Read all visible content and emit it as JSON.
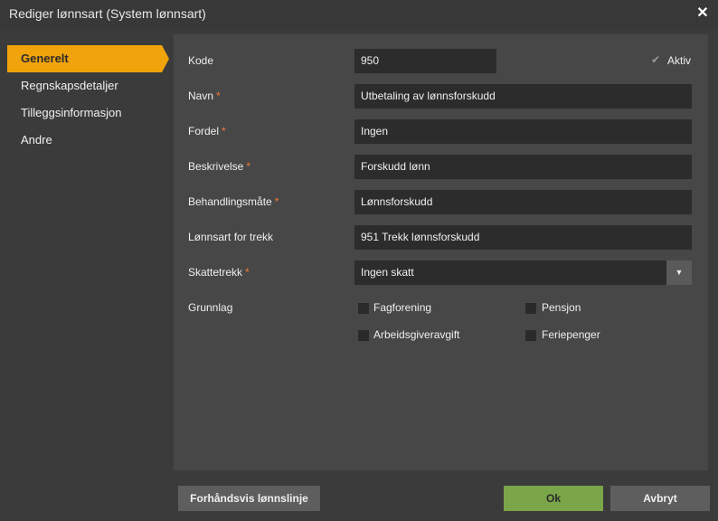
{
  "window": {
    "title": "Rediger lønnsart (System lønnsart)"
  },
  "sidebar": {
    "items": [
      {
        "label": "Generelt"
      },
      {
        "label": "Regnskapsdetaljer"
      },
      {
        "label": "Tilleggsinformasjon"
      },
      {
        "label": "Andre"
      }
    ]
  },
  "form": {
    "kode": {
      "label": "Kode",
      "value": "950"
    },
    "aktiv": {
      "label": "Aktiv",
      "checked": true
    },
    "navn": {
      "label": "Navn",
      "value": "Utbetaling av lønnsforskudd"
    },
    "fordel": {
      "label": "Fordel",
      "value": "Ingen"
    },
    "beskrivelse": {
      "label": "Beskrivelse",
      "value": "Forskudd lønn"
    },
    "behandlingsmate": {
      "label": "Behandlingsmåte",
      "value": "Lønnsforskudd"
    },
    "lonnsart_trekk": {
      "label": "Lønnsart for trekk",
      "value": "951 Trekk lønnsforskudd"
    },
    "skattetrekk": {
      "label": "Skattetrekk",
      "value": "Ingen skatt"
    },
    "grunnlag": {
      "label": "Grunnlag",
      "options": [
        {
          "label": "Fagforening",
          "checked": false
        },
        {
          "label": "Pensjon",
          "checked": false
        },
        {
          "label": "Arbeidsgiveravgift",
          "checked": false
        },
        {
          "label": "Feriepenger",
          "checked": false
        }
      ]
    },
    "required_marker": "*"
  },
  "footer": {
    "preview_label": "Forhåndsvis lønnslinje",
    "ok_label": "Ok",
    "cancel_label": "Avbryt"
  },
  "colors": {
    "accent": "#f0a30a",
    "ok": "#7aa548",
    "required": "#f07b3a"
  }
}
